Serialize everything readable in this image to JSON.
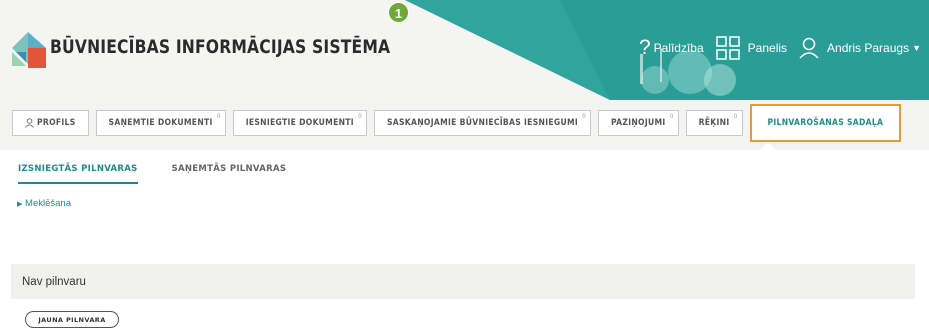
{
  "header": {
    "title": "BŪVNIECĪBAS INFORMĀCIJAS SISTĒMA",
    "step_badge": "1",
    "help_label": "Palīdzība",
    "panel_label": "Panelis",
    "user_label": "Andris Paraugs",
    "accent_color": "#2a9d97"
  },
  "tabs": [
    {
      "label": "PROFILS",
      "count": ""
    },
    {
      "label": "SAŅEMTIE DOKUMENTI",
      "count": "0"
    },
    {
      "label": "IESNIEGTIE DOKUMENTI",
      "count": "0"
    },
    {
      "label": "SASKAŅOJAMIE BŪVNIECĪBAS IESNIEGUMI",
      "count": "0"
    },
    {
      "label": "PAZIŅOJUMI",
      "count": "0"
    },
    {
      "label": "RĒĶINI",
      "count": "0"
    },
    {
      "label": "PILNVAROŠANAS SADAĻA",
      "count": ""
    }
  ],
  "subtabs": [
    {
      "label": "IZSNIEGTĀS PILNVARAS"
    },
    {
      "label": "SAŅEMTĀS PILNVARAS"
    }
  ],
  "search_toggle": "Meklēšana",
  "empty_message": "Nav pilnvaru",
  "new_button": "JAUNA PILNVARA",
  "colors": {
    "teal": "#1e8c8c",
    "highlight_orange": "#e39a3b",
    "badge_green": "#6ea93a"
  }
}
